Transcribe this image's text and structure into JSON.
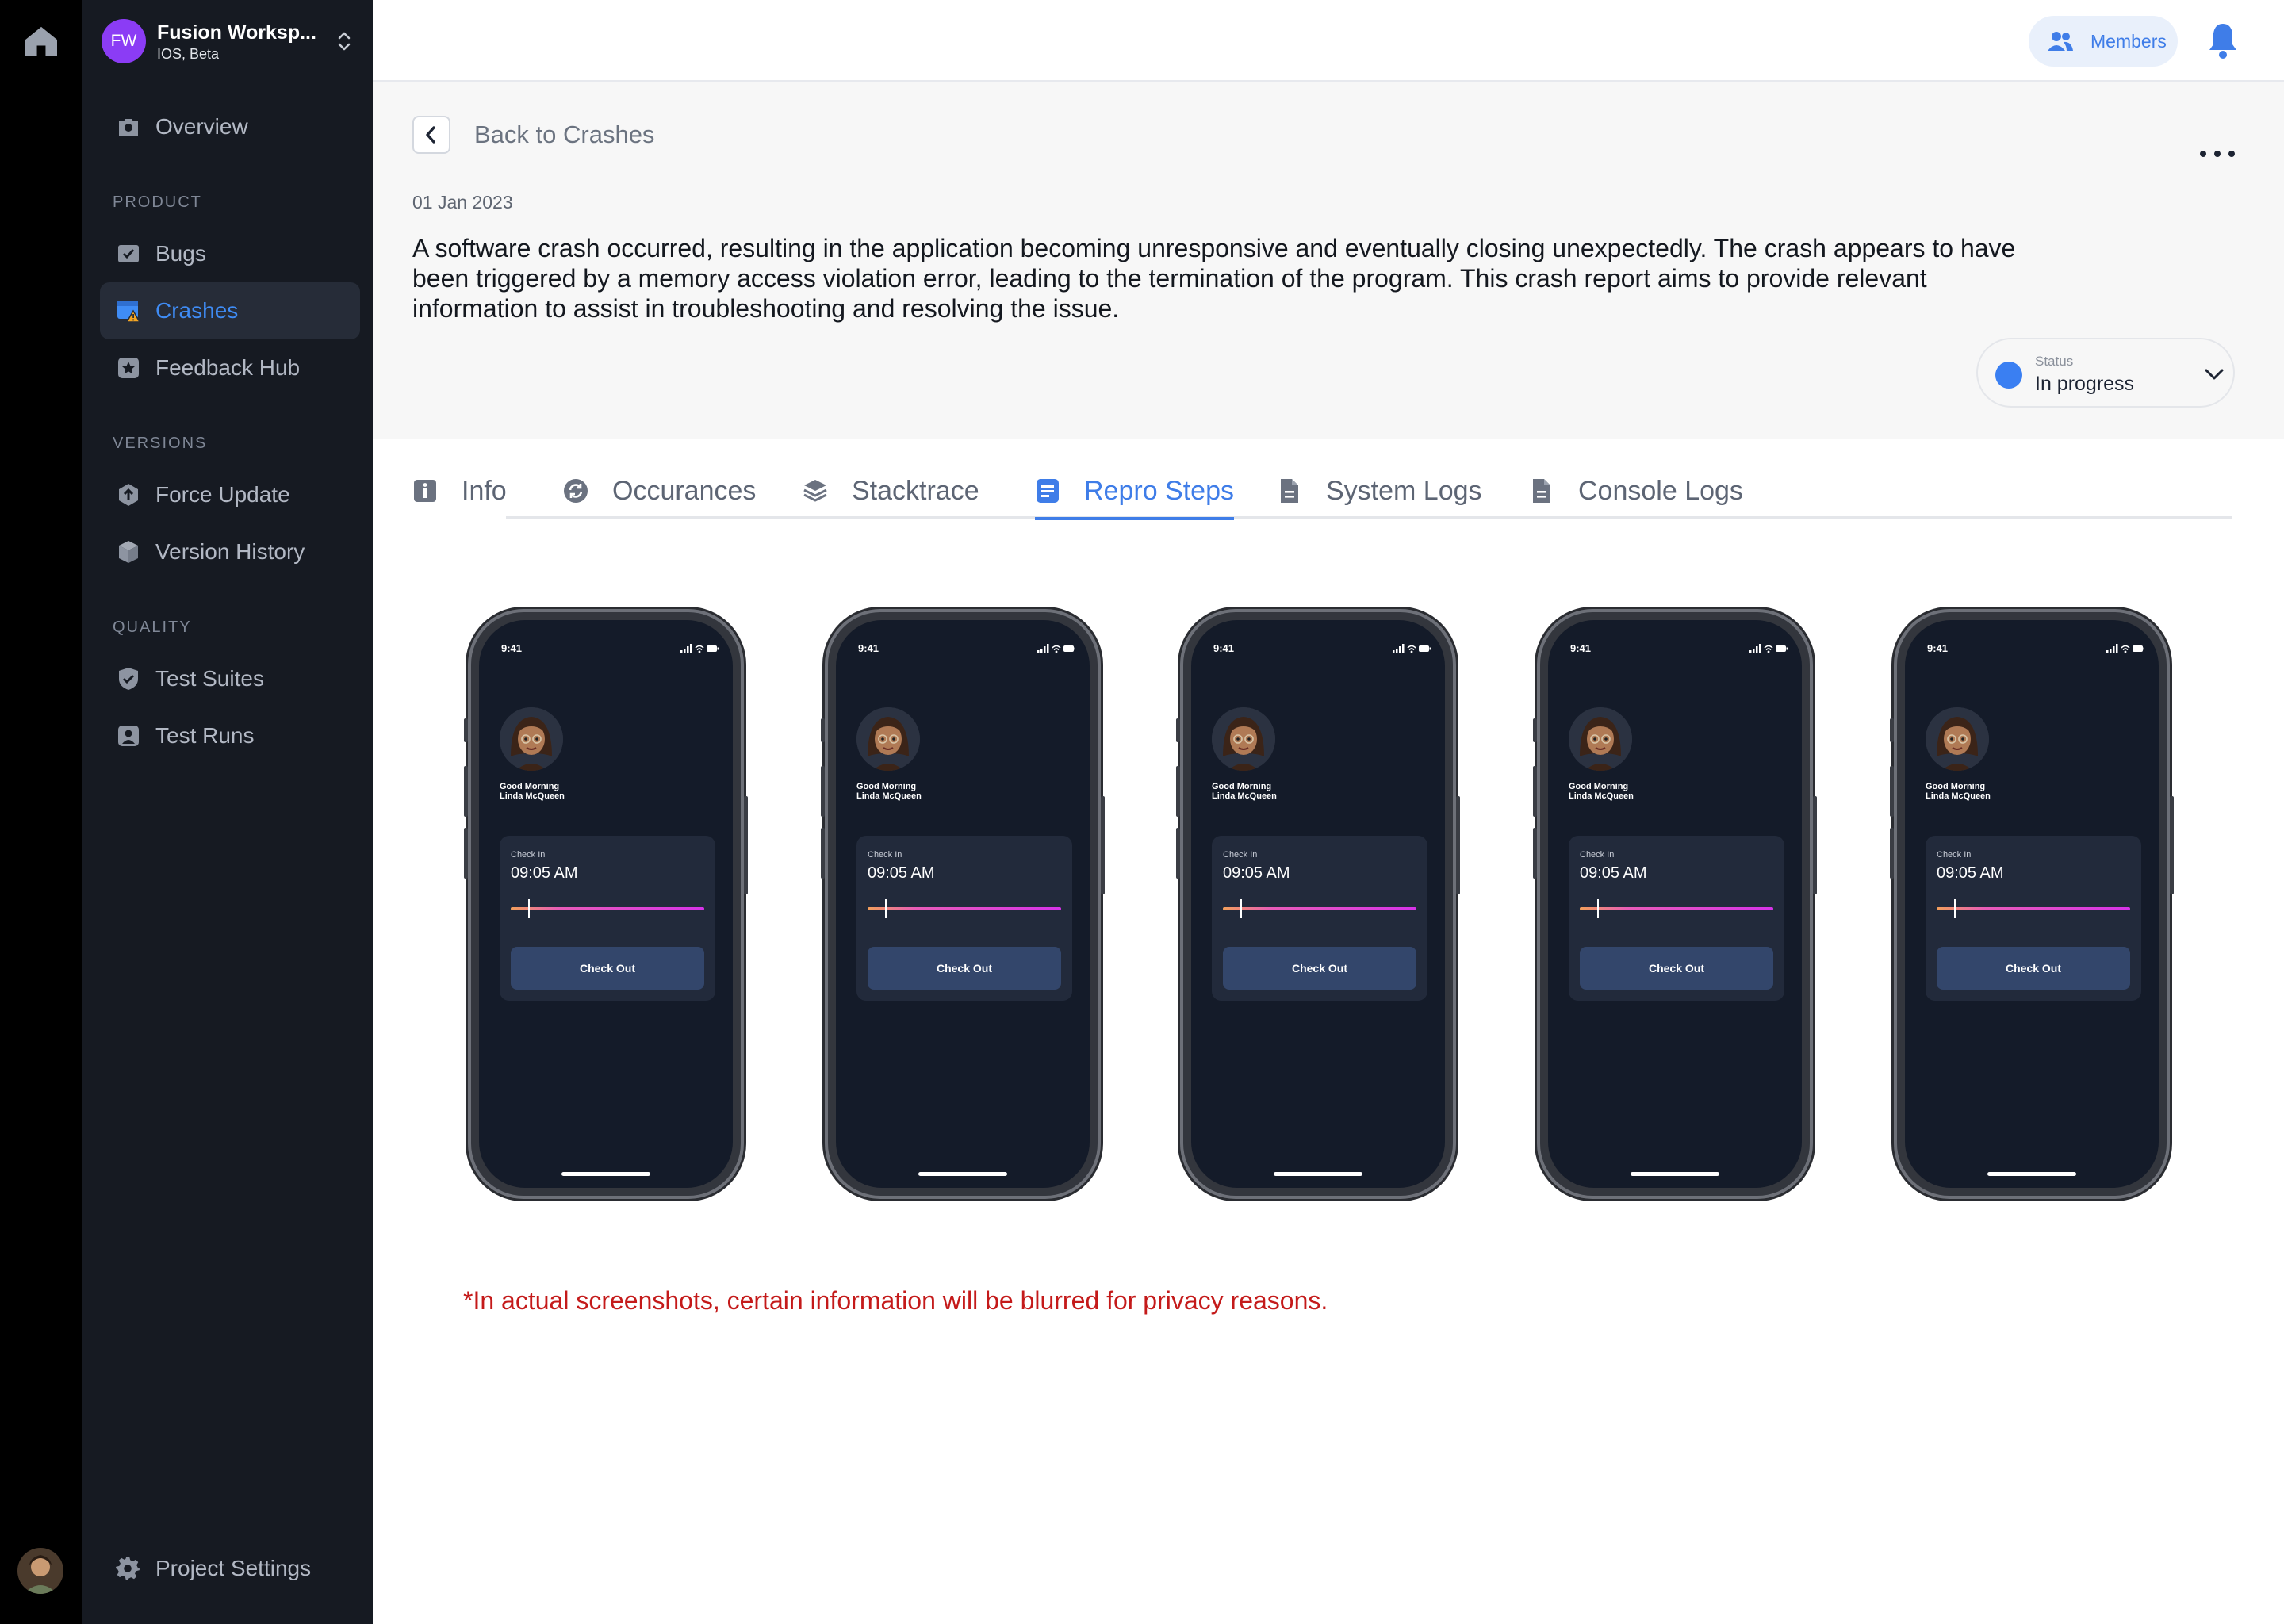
{
  "workspace": {
    "initials": "FW",
    "name": "Fusion Worksp...",
    "subtitle": "IOS, Beta"
  },
  "sidebar": {
    "overview": "Overview",
    "sections": {
      "product": "PRODUCT",
      "versions": "VERSIONS",
      "quality": "QUALITY"
    },
    "items": [
      {
        "label": "Bugs"
      },
      {
        "label": "Crashes",
        "active": true
      },
      {
        "label": "Feedback Hub"
      },
      {
        "label": "Force Update"
      },
      {
        "label": "Version History"
      },
      {
        "label": "Test Suites"
      },
      {
        "label": "Test Runs"
      }
    ],
    "settings": "Project Settings"
  },
  "topbar": {
    "members_label": "Members"
  },
  "header": {
    "back_label": "Back to Crashes",
    "date": "01 Jan 2023",
    "description": "A software crash occurred, resulting in the application becoming unresponsive and eventually closing unexpectedly. The crash appears to have been triggered by a memory access violation error, leading to the termination of the program. This crash report aims to provide relevant information to assist in troubleshooting and resolving the issue.",
    "status_key": "Status",
    "status_value": "In progress",
    "status_color": "#3a7ff2"
  },
  "tabs": [
    {
      "label": "Info",
      "icon": "info-icon"
    },
    {
      "label": "Occurances",
      "icon": "refresh-icon"
    },
    {
      "label": "Stacktrace",
      "icon": "layers-icon"
    },
    {
      "label": "Repro Steps",
      "icon": "list-doc-icon",
      "active": true
    },
    {
      "label": "System Logs",
      "icon": "document-icon"
    },
    {
      "label": "Console Logs",
      "icon": "document-icon"
    }
  ],
  "phone_screen": {
    "time": "9:41",
    "greeting_line1": "Good Morning",
    "greeting_line2": "Linda McQueen",
    "check_in_label": "Check In",
    "check_in_time": "09:05 AM",
    "check_out_label": "Check Out"
  },
  "note": "*In actual screenshots, certain information will be blurred for privacy reasons.",
  "colors": {
    "accent": "#3f7de8",
    "sidebar_bg": "#161a22",
    "note_red": "#c41a1a"
  }
}
